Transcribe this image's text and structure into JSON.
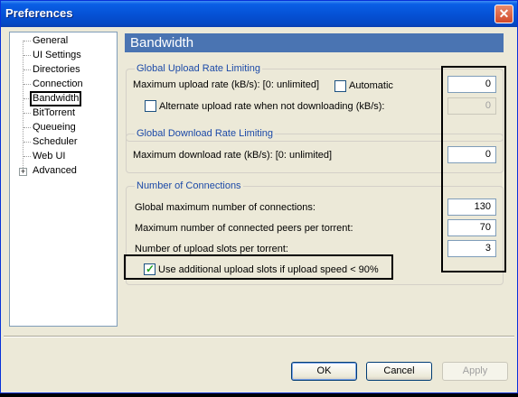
{
  "window": {
    "title": "Preferences"
  },
  "sidebar": {
    "items": [
      {
        "label": "General"
      },
      {
        "label": "UI Settings"
      },
      {
        "label": "Directories"
      },
      {
        "label": "Connection"
      },
      {
        "label": "Bandwidth"
      },
      {
        "label": "BitTorrent"
      },
      {
        "label": "Queueing"
      },
      {
        "label": "Scheduler"
      },
      {
        "label": "Web UI"
      },
      {
        "label": "Advanced"
      }
    ],
    "selected": "Bandwidth"
  },
  "panel": {
    "title": "Bandwidth"
  },
  "upload": {
    "group_title": "Global Upload Rate Limiting",
    "max_label": "Maximum upload rate (kB/s): [0: unlimited]",
    "max_value": "0",
    "automatic_label": "Automatic",
    "automatic_checked": false,
    "alternate_label": "Alternate upload rate when not downloading (kB/s):",
    "alternate_checked": false,
    "alternate_value": "0"
  },
  "download": {
    "group_title": "Global Download Rate Limiting",
    "max_label": "Maximum download rate (kB/s): [0: unlimited]",
    "max_value": "0"
  },
  "connections": {
    "group_title": "Number of Connections",
    "global_max_label": "Global maximum number of connections:",
    "global_max_value": "130",
    "peers_label": "Maximum number of connected peers per torrent:",
    "peers_value": "70",
    "slots_label": "Number of upload slots per torrent:",
    "slots_value": "3",
    "extra_slots_label": "Use additional upload slots if upload speed < 90%",
    "extra_slots_checked": true
  },
  "buttons": {
    "ok": "OK",
    "cancel": "Cancel",
    "apply": "Apply"
  },
  "colors": {
    "title_bar": "#0552d6",
    "panel_header": "#4a74b2",
    "group_title": "#1c4aa8"
  }
}
